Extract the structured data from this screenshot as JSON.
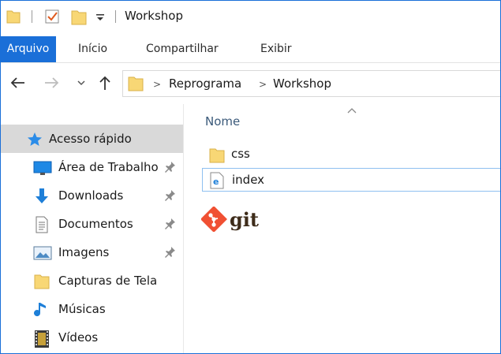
{
  "window": {
    "title": "Workshop"
  },
  "ribbon": {
    "tabs": [
      {
        "label": "Arquivo",
        "active": true
      },
      {
        "label": "Início"
      },
      {
        "label": "Compartilhar"
      },
      {
        "label": "Exibir"
      }
    ]
  },
  "address": {
    "crumbs": [
      "Reprograma",
      "Workshop"
    ]
  },
  "nav": {
    "items": [
      {
        "label": "Acesso rápido",
        "icon": "star-icon"
      },
      {
        "label": "Área de Trabalho",
        "icon": "desktop-icon"
      },
      {
        "label": "Downloads",
        "icon": "download-arrow-icon"
      },
      {
        "label": "Documentos",
        "icon": "document-icon"
      },
      {
        "label": "Imagens",
        "icon": "image-icon"
      },
      {
        "label": "Capturas de Tela",
        "icon": "folder-icon"
      },
      {
        "label": "Músicas",
        "icon": "music-note-icon"
      },
      {
        "label": "Vídeos",
        "icon": "film-icon"
      }
    ]
  },
  "content": {
    "column_header": "Nome",
    "files": [
      {
        "name": "css",
        "icon": "folder-icon"
      },
      {
        "name": "index",
        "icon": "edge-html-file-icon"
      }
    ],
    "logo_text": "git"
  },
  "colors": {
    "accent": "#1a6fd8",
    "folder": "#f8d775",
    "git": "#f05033"
  }
}
